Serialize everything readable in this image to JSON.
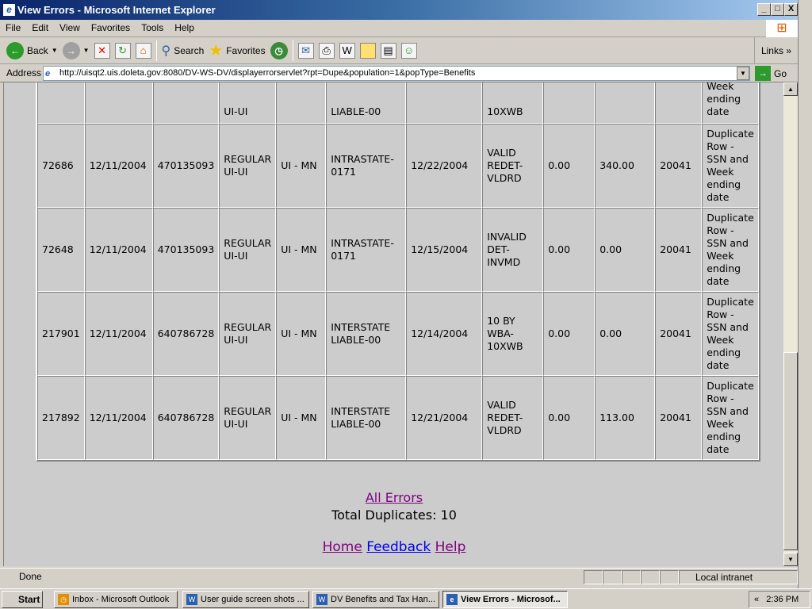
{
  "window": {
    "title": "View Errors - Microsoft Internet Explorer",
    "min": "_",
    "max": "□",
    "close": "X"
  },
  "menu": [
    "File",
    "Edit",
    "View",
    "Favorites",
    "Tools",
    "Help"
  ],
  "toolbar": {
    "back": "Back",
    "search": "Search",
    "favorites": "Favorites",
    "links": "Links"
  },
  "address": {
    "label": "Address",
    "url": "http://uisqt2.uis.doleta.gov:8080/DV-WS-DV/displayerrorservlet?rpt=Dupe&population=1&popType=Benefits",
    "go": "Go"
  },
  "table": {
    "partial_row": [
      "",
      "",
      "",
      "UI-UI",
      "",
      "LIABLE-00",
      "",
      "10XWB",
      "",
      "",
      "",
      "Week ending date"
    ],
    "rows": [
      [
        "72686",
        "12/11/2004",
        "470135093",
        "REGULAR UI-UI",
        "UI - MN",
        "INTRASTATE-0171",
        "12/22/2004",
        "VALID REDET-VLDRD",
        "0.00",
        "340.00",
        "20041",
        "Duplicate Row - SSN and Week ending date"
      ],
      [
        "72648",
        "12/11/2004",
        "470135093",
        "REGULAR UI-UI",
        "UI - MN",
        "INTRASTATE-0171",
        "12/15/2004",
        "INVALID DET-INVMD",
        "0.00",
        "0.00",
        "20041",
        "Duplicate Row - SSN and Week ending date"
      ],
      [
        "217901",
        "12/11/2004",
        "640786728",
        "REGULAR UI-UI",
        "UI - MN",
        "INTERSTATE LIABLE-00",
        "12/14/2004",
        "10 BY WBA-10XWB",
        "0.00",
        "0.00",
        "20041",
        "Duplicate Row - SSN and Week ending date"
      ],
      [
        "217892",
        "12/11/2004",
        "640786728",
        "REGULAR UI-UI",
        "UI - MN",
        "INTERSTATE LIABLE-00",
        "12/21/2004",
        "VALID REDET-VLDRD",
        "0.00",
        "113.00",
        "20041",
        "Duplicate Row - SSN and Week ending date"
      ]
    ]
  },
  "footer": {
    "all_errors": "All Errors",
    "total": "Total Duplicates: 10",
    "home": "Home",
    "feedback": "Feedback",
    "help": "Help"
  },
  "status": {
    "text": "Done",
    "zone": "Local intranet"
  },
  "taskbar": {
    "start": "Start",
    "tasks": [
      "Inbox - Microsoft Outlook",
      "User guide screen shots ...",
      "DV Benefits and Tax Han...",
      "View Errors - Microsof..."
    ],
    "clock": "2:36 PM",
    "chevron": "«"
  }
}
